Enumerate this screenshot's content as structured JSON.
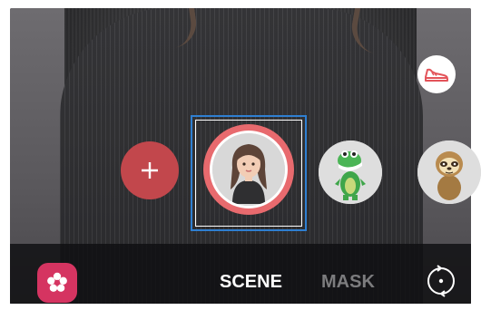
{
  "camera": {
    "mode_tabs": [
      {
        "label": "SCENE",
        "active": true
      },
      {
        "label": "MASK",
        "active": false
      }
    ],
    "add_button_icon": "plus-icon",
    "sticker_button_icon": "sneaker-icon",
    "bixby_button_icon": "flower-icon",
    "switch_camera_icon": "switch-camera-icon",
    "emojis": [
      {
        "name": "my-emoji-avatar",
        "selected": true
      },
      {
        "name": "dinosaur-emoji",
        "selected": false
      },
      {
        "name": "sloth-emoji",
        "selected": false
      }
    ]
  },
  "colors": {
    "accent_red": "#e86a6e",
    "add_button": "#c2474c",
    "bixby_pink": "#d53461",
    "selection_blue": "#2f7fd1",
    "active_tab": "#ffffff",
    "inactive_tab": "#7c7c7e"
  }
}
